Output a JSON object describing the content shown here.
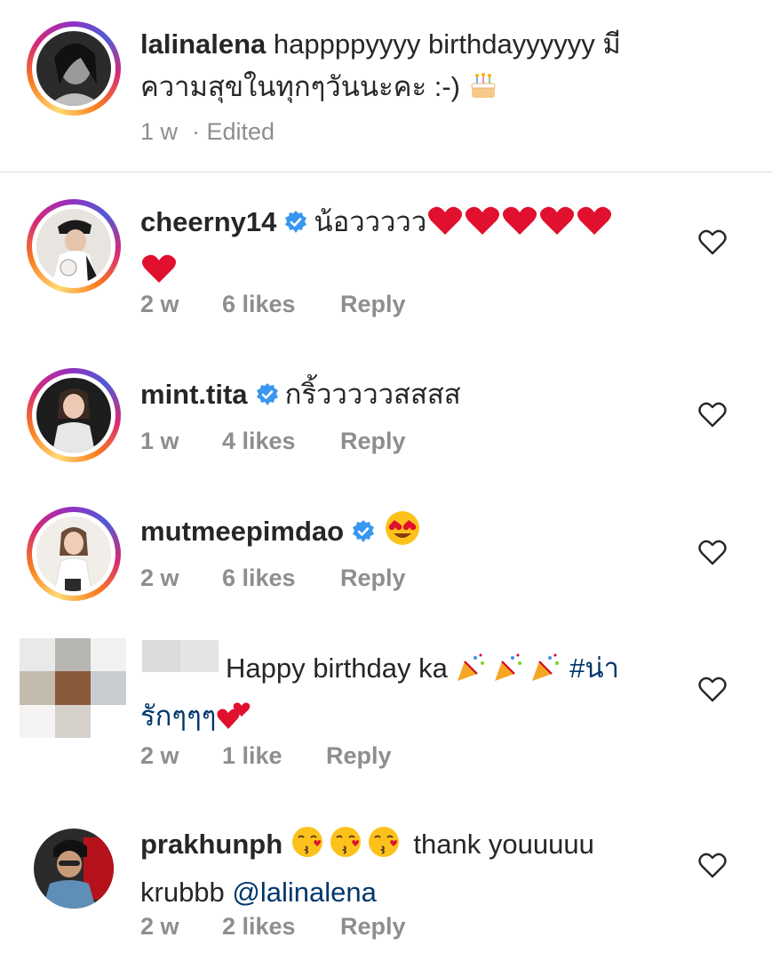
{
  "comments": [
    {
      "username": "lalinalena",
      "text_line1": "happppyyyy birthdayyyyyy มี",
      "text_line2": "ความสุขในทุกๆวันนะคะ :-)",
      "time": "1 w",
      "edited": "· Edited",
      "emoji": "birthday-cake-icon"
    },
    {
      "username": "cheerny14",
      "verified": true,
      "text": "น้อววววว",
      "emoji": "red-heart-icon",
      "time": "2 w",
      "likes": "6 likes",
      "reply": "Reply"
    },
    {
      "username": "mint.tita",
      "verified": true,
      "text": "กริ้วววววสสสส",
      "time": "1 w",
      "likes": "4 likes",
      "reply": "Reply"
    },
    {
      "username": "mutmeepimdao",
      "verified": true,
      "emoji": "heart-eyes-icon",
      "time": "2 w",
      "likes": "6 likes",
      "reply": "Reply"
    },
    {
      "username_hidden": true,
      "text": "Happy birthday ka",
      "hashtag_part1": "#น่า",
      "hashtag_part2": "รักๆๆๆ",
      "emoji": "party-popper-icon",
      "time": "2 w",
      "likes": "1 like",
      "reply": "Reply"
    },
    {
      "username": "prakhunph",
      "text": "thank youuuuu",
      "text_line2": "krubbb",
      "mention": "@lalinalena",
      "emoji": "kissing-face-icon",
      "time": "2 w",
      "likes": "2 likes",
      "reply": "Reply"
    }
  ],
  "colors": {
    "text": "#262626",
    "meta": "#8e8e8e",
    "verified": "#3897f0",
    "link": "#00376b",
    "heart_red": "#e0102e"
  }
}
